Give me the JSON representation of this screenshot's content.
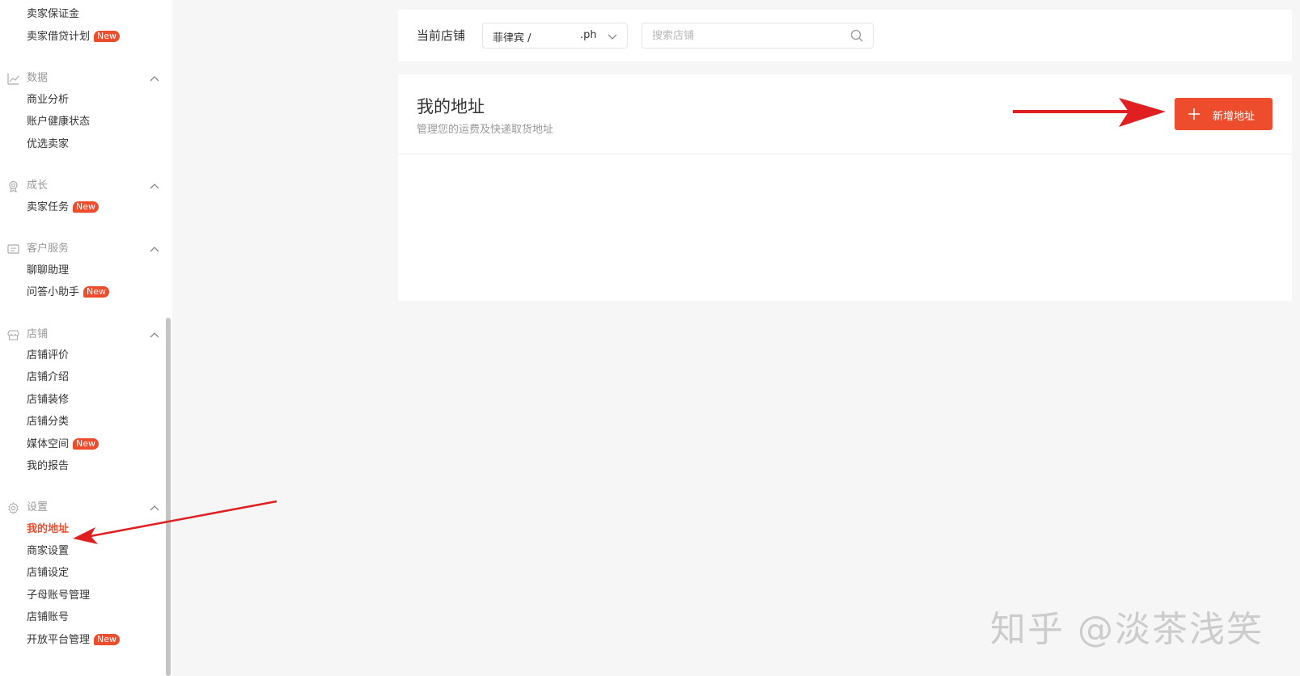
{
  "sidebar": {
    "items_top": [
      {
        "label": "卖家保证金",
        "badge": ""
      },
      {
        "label": "卖家借贷计划",
        "badge": "New"
      }
    ],
    "sections": [
      {
        "title": "数据",
        "icon": "chart-icon",
        "items": [
          {
            "label": "商业分析"
          },
          {
            "label": "账户健康状态"
          },
          {
            "label": "优选卖家"
          }
        ]
      },
      {
        "title": "成长",
        "icon": "medal-icon",
        "items": [
          {
            "label": "卖家任务",
            "badge": "New"
          }
        ]
      },
      {
        "title": "客户服务",
        "icon": "chat-icon",
        "items": [
          {
            "label": "聊聊助理"
          },
          {
            "label": "问答小助手",
            "badge": "New"
          }
        ]
      },
      {
        "title": "店铺",
        "icon": "shop-icon",
        "items": [
          {
            "label": "店铺评价"
          },
          {
            "label": "店铺介绍"
          },
          {
            "label": "店铺装修"
          },
          {
            "label": "店铺分类"
          },
          {
            "label": "媒体空间",
            "badge": "New"
          },
          {
            "label": "我的报告"
          }
        ]
      },
      {
        "title": "设置",
        "icon": "gear-icon",
        "items": [
          {
            "label": "我的地址",
            "active": true
          },
          {
            "label": "商家设置"
          },
          {
            "label": "店铺设定"
          },
          {
            "label": "子母账号管理"
          },
          {
            "label": "店铺账号"
          },
          {
            "label": "开放平台管理",
            "badge": "New"
          }
        ]
      }
    ]
  },
  "shopbar": {
    "label": "当前店铺",
    "selected_region": "菲律宾 /",
    "selected_suffix": ".ph",
    "search_placeholder": "搜索店铺"
  },
  "address_panel": {
    "title": "我的地址",
    "subtitle": "管理您的运费及快递取货地址",
    "add_button_label": "新增地址"
  },
  "watermark": "知乎 @淡茶浅笑",
  "colors": {
    "accent": "#ee4d2d",
    "background": "#f6f6f6",
    "annotation_arrow": "#e02020"
  }
}
